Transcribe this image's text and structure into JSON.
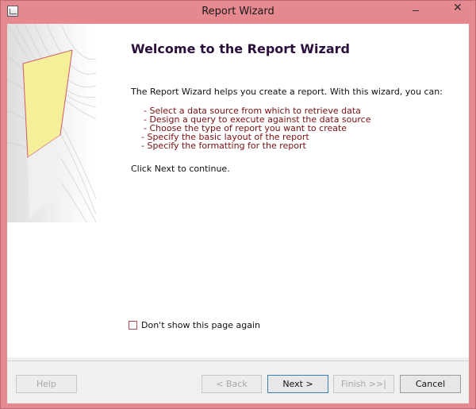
{
  "window": {
    "title": "Report Wizard",
    "close_glyph": "✕"
  },
  "main": {
    "heading": "Welcome to the Report Wizard",
    "intro": "The Report Wizard helps you create a report. With this wizard, you can:",
    "bullets": [
      "- Select a data source from which to retrieve data",
      "- Design a query to execute against the data source",
      "- Choose the type of report you want to create",
      "- Specify the basic layout of the report",
      "- Specify the formatting for the report"
    ],
    "continue_text": "Click Next to continue."
  },
  "option": {
    "label": "Don't show this page again",
    "checked": false
  },
  "buttons": {
    "help": "Help",
    "back": "< Back",
    "next": "Next >",
    "finish": "Finish >>|",
    "cancel": "Cancel"
  },
  "icons": {
    "app": "report-wizard-icon",
    "art": "wizard-document-illustration"
  },
  "colors": {
    "window_frame": "#e6888f",
    "heading": "#2a0f3a",
    "bullet_text": "#7a0f12",
    "illustration_page": "#f6ef9a"
  }
}
